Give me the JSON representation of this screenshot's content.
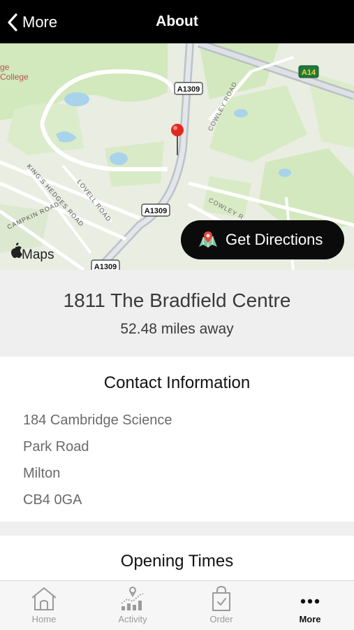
{
  "header": {
    "back_label": "More",
    "title": "About"
  },
  "map": {
    "labels": {
      "college": [
        "ge",
        "College"
      ],
      "roads": [
        "A1309",
        "A1309",
        "A1309",
        "A14"
      ],
      "streets": [
        "COWLEY ROAD",
        "COWLEY R",
        "KING'S HEDGES ROAD",
        "LOVELL ROAD",
        "CAMPKIN ROAD"
      ],
      "attribution": "Maps"
    },
    "directions_label": "Get Directions"
  },
  "location": {
    "name": "1811 The Bradfield Centre",
    "distance": "52.48 miles away"
  },
  "contact": {
    "title": "Contact Information",
    "address_lines": [
      "184 Cambridge Science",
      "Park Road",
      "Milton",
      "CB4 0GA"
    ]
  },
  "opening": {
    "title": "Opening Times"
  },
  "tabbar": {
    "items": [
      {
        "label": "Home",
        "icon": "home-icon",
        "active": false
      },
      {
        "label": "Activity",
        "icon": "activity-icon",
        "active": false
      },
      {
        "label": "Order",
        "icon": "bag-icon",
        "active": false
      },
      {
        "label": "More",
        "icon": "more-icon",
        "active": true
      }
    ]
  },
  "colors": {
    "header_bg": "#000000",
    "pin": "#e02a1f",
    "map_green": "#cfe6b6",
    "map_water": "#a9d3ea",
    "tab_active": "#111111",
    "tab_inactive": "#9a9a9a"
  }
}
